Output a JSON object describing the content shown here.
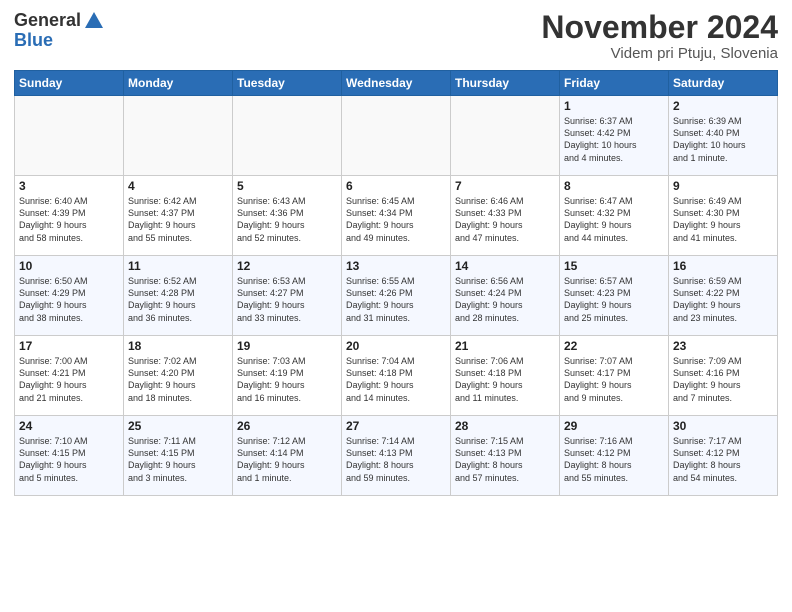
{
  "header": {
    "logo_line1": "General",
    "logo_line2": "Blue",
    "month_title": "November 2024",
    "location": "Videm pri Ptuju, Slovenia"
  },
  "weekdays": [
    "Sunday",
    "Monday",
    "Tuesday",
    "Wednesday",
    "Thursday",
    "Friday",
    "Saturday"
  ],
  "weeks": [
    [
      {
        "day": "",
        "info": ""
      },
      {
        "day": "",
        "info": ""
      },
      {
        "day": "",
        "info": ""
      },
      {
        "day": "",
        "info": ""
      },
      {
        "day": "",
        "info": ""
      },
      {
        "day": "1",
        "info": "Sunrise: 6:37 AM\nSunset: 4:42 PM\nDaylight: 10 hours\nand 4 minutes."
      },
      {
        "day": "2",
        "info": "Sunrise: 6:39 AM\nSunset: 4:40 PM\nDaylight: 10 hours\nand 1 minute."
      }
    ],
    [
      {
        "day": "3",
        "info": "Sunrise: 6:40 AM\nSunset: 4:39 PM\nDaylight: 9 hours\nand 58 minutes."
      },
      {
        "day": "4",
        "info": "Sunrise: 6:42 AM\nSunset: 4:37 PM\nDaylight: 9 hours\nand 55 minutes."
      },
      {
        "day": "5",
        "info": "Sunrise: 6:43 AM\nSunset: 4:36 PM\nDaylight: 9 hours\nand 52 minutes."
      },
      {
        "day": "6",
        "info": "Sunrise: 6:45 AM\nSunset: 4:34 PM\nDaylight: 9 hours\nand 49 minutes."
      },
      {
        "day": "7",
        "info": "Sunrise: 6:46 AM\nSunset: 4:33 PM\nDaylight: 9 hours\nand 47 minutes."
      },
      {
        "day": "8",
        "info": "Sunrise: 6:47 AM\nSunset: 4:32 PM\nDaylight: 9 hours\nand 44 minutes."
      },
      {
        "day": "9",
        "info": "Sunrise: 6:49 AM\nSunset: 4:30 PM\nDaylight: 9 hours\nand 41 minutes."
      }
    ],
    [
      {
        "day": "10",
        "info": "Sunrise: 6:50 AM\nSunset: 4:29 PM\nDaylight: 9 hours\nand 38 minutes."
      },
      {
        "day": "11",
        "info": "Sunrise: 6:52 AM\nSunset: 4:28 PM\nDaylight: 9 hours\nand 36 minutes."
      },
      {
        "day": "12",
        "info": "Sunrise: 6:53 AM\nSunset: 4:27 PM\nDaylight: 9 hours\nand 33 minutes."
      },
      {
        "day": "13",
        "info": "Sunrise: 6:55 AM\nSunset: 4:26 PM\nDaylight: 9 hours\nand 31 minutes."
      },
      {
        "day": "14",
        "info": "Sunrise: 6:56 AM\nSunset: 4:24 PM\nDaylight: 9 hours\nand 28 minutes."
      },
      {
        "day": "15",
        "info": "Sunrise: 6:57 AM\nSunset: 4:23 PM\nDaylight: 9 hours\nand 25 minutes."
      },
      {
        "day": "16",
        "info": "Sunrise: 6:59 AM\nSunset: 4:22 PM\nDaylight: 9 hours\nand 23 minutes."
      }
    ],
    [
      {
        "day": "17",
        "info": "Sunrise: 7:00 AM\nSunset: 4:21 PM\nDaylight: 9 hours\nand 21 minutes."
      },
      {
        "day": "18",
        "info": "Sunrise: 7:02 AM\nSunset: 4:20 PM\nDaylight: 9 hours\nand 18 minutes."
      },
      {
        "day": "19",
        "info": "Sunrise: 7:03 AM\nSunset: 4:19 PM\nDaylight: 9 hours\nand 16 minutes."
      },
      {
        "day": "20",
        "info": "Sunrise: 7:04 AM\nSunset: 4:18 PM\nDaylight: 9 hours\nand 14 minutes."
      },
      {
        "day": "21",
        "info": "Sunrise: 7:06 AM\nSunset: 4:18 PM\nDaylight: 9 hours\nand 11 minutes."
      },
      {
        "day": "22",
        "info": "Sunrise: 7:07 AM\nSunset: 4:17 PM\nDaylight: 9 hours\nand 9 minutes."
      },
      {
        "day": "23",
        "info": "Sunrise: 7:09 AM\nSunset: 4:16 PM\nDaylight: 9 hours\nand 7 minutes."
      }
    ],
    [
      {
        "day": "24",
        "info": "Sunrise: 7:10 AM\nSunset: 4:15 PM\nDaylight: 9 hours\nand 5 minutes."
      },
      {
        "day": "25",
        "info": "Sunrise: 7:11 AM\nSunset: 4:15 PM\nDaylight: 9 hours\nand 3 minutes."
      },
      {
        "day": "26",
        "info": "Sunrise: 7:12 AM\nSunset: 4:14 PM\nDaylight: 9 hours\nand 1 minute."
      },
      {
        "day": "27",
        "info": "Sunrise: 7:14 AM\nSunset: 4:13 PM\nDaylight: 8 hours\nand 59 minutes."
      },
      {
        "day": "28",
        "info": "Sunrise: 7:15 AM\nSunset: 4:13 PM\nDaylight: 8 hours\nand 57 minutes."
      },
      {
        "day": "29",
        "info": "Sunrise: 7:16 AM\nSunset: 4:12 PM\nDaylight: 8 hours\nand 55 minutes."
      },
      {
        "day": "30",
        "info": "Sunrise: 7:17 AM\nSunset: 4:12 PM\nDaylight: 8 hours\nand 54 minutes."
      }
    ]
  ]
}
